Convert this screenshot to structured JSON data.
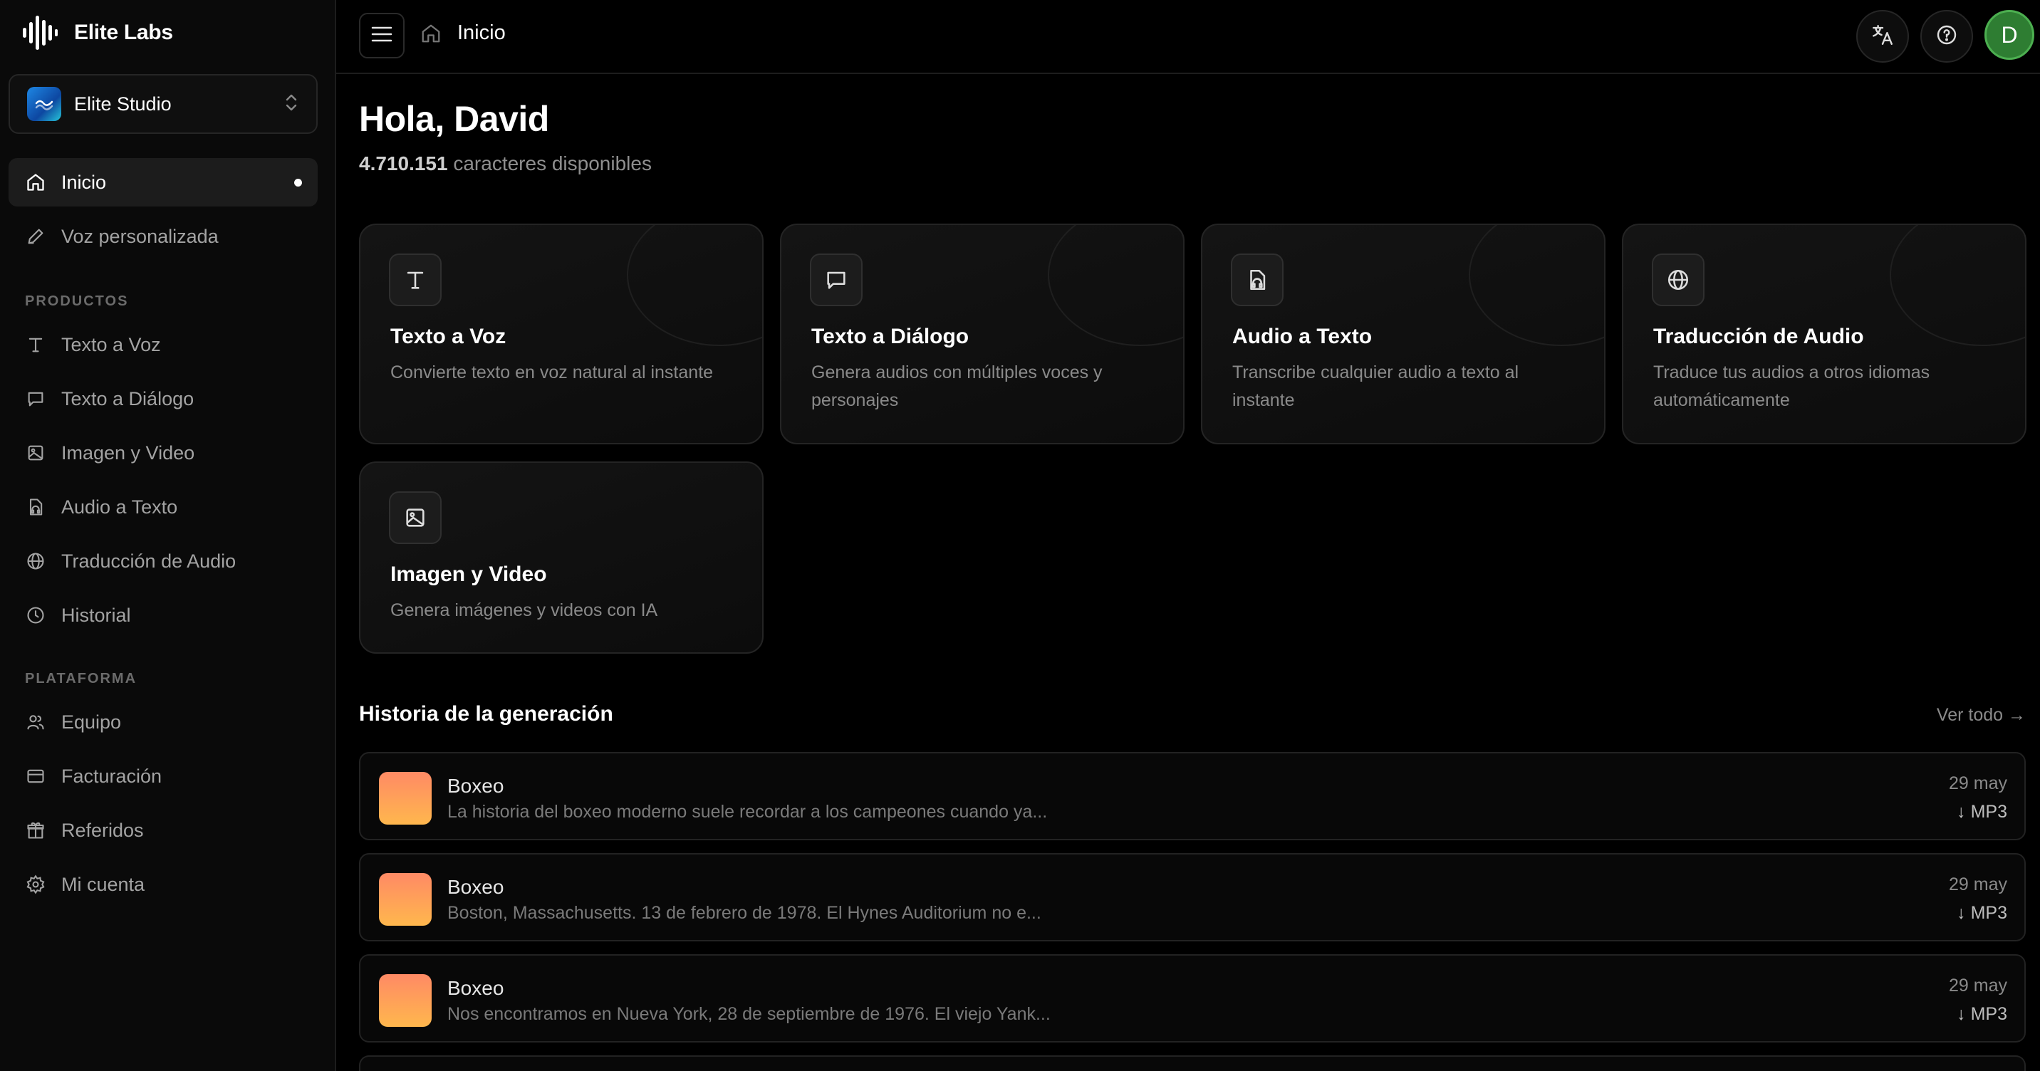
{
  "brand": {
    "name": "Elite Labs"
  },
  "workspace": {
    "name": "Elite Studio"
  },
  "sidebar": {
    "top_items": [
      {
        "label": "Inicio",
        "icon": "home-icon",
        "active": true
      },
      {
        "label": "Voz personalizada",
        "icon": "pen-icon"
      }
    ],
    "sections": [
      {
        "label": "PRODUCTOS",
        "items": [
          {
            "label": "Texto a Voz",
            "icon": "text-icon"
          },
          {
            "label": "Texto a Diálogo",
            "icon": "chat-icon"
          },
          {
            "label": "Imagen y Video",
            "icon": "image-icon"
          },
          {
            "label": "Audio a Texto",
            "icon": "audio-file-icon"
          },
          {
            "label": "Traducción de Audio",
            "icon": "globe-icon"
          },
          {
            "label": "Historial",
            "icon": "clock-icon"
          }
        ]
      },
      {
        "label": "PLATAFORMA",
        "items": [
          {
            "label": "Equipo",
            "icon": "users-icon"
          },
          {
            "label": "Facturación",
            "icon": "credit-card-icon"
          },
          {
            "label": "Referidos",
            "icon": "gift-icon"
          },
          {
            "label": "Mi cuenta",
            "icon": "gear-icon"
          }
        ]
      }
    ]
  },
  "header": {
    "breadcrumb": "Inicio",
    "avatar_initial": "D",
    "avatar_color": "#2e7d32"
  },
  "main": {
    "greeting": "Hola, David",
    "chars_count": "4.710.151",
    "chars_label": "caracteres disponibles",
    "cards": [
      {
        "title": "Texto a Voz",
        "desc": "Convierte texto en voz natural al instante",
        "icon": "text-icon"
      },
      {
        "title": "Texto a Diálogo",
        "desc": "Genera audios con múltiples voces y personajes",
        "icon": "chat-icon"
      },
      {
        "title": "Audio a Texto",
        "desc": "Transcribe cualquier audio a texto al instante",
        "icon": "audio-file-icon"
      },
      {
        "title": "Traducción de Audio",
        "desc": "Traduce tus audios a otros idiomas automáticamente",
        "icon": "globe-icon"
      },
      {
        "title": "Imagen y Video",
        "desc": "Genera imágenes y videos con IA",
        "icon": "image-icon"
      }
    ],
    "history": {
      "title": "Historia de la generación",
      "view_all": "Ver todo →",
      "rows": [
        {
          "title": "Boxeo",
          "subtitle": "La historia del boxeo moderno suele recordar a los campeones cuando ya...",
          "date": "29 may",
          "format": "↓ MP3"
        },
        {
          "title": "Boxeo",
          "subtitle": "Boston, Massachusetts. 13 de febrero de 1978. El Hynes Auditorium no e...",
          "date": "29 may",
          "format": "↓ MP3"
        },
        {
          "title": "Boxeo",
          "subtitle": "Nos encontramos en Nueva York, 28 de septiembre de 1976. El viejo Yank...",
          "date": "29 may",
          "format": "↓ MP3"
        }
      ]
    }
  }
}
